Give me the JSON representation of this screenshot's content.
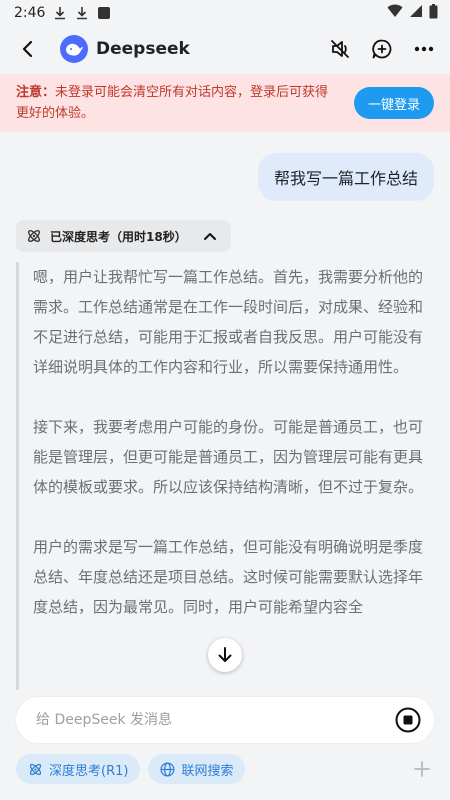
{
  "status_bar": {
    "time": "2:46",
    "icons": [
      "download-icon",
      "download-icon",
      "app-square-icon",
      "wifi-icon",
      "signal-icon",
      "battery-icon"
    ]
  },
  "header": {
    "title": "Deepseek",
    "icons": [
      "back-arrow-icon",
      "deepseek-whale-icon",
      "mute-icon",
      "new-chat-icon",
      "more-icon"
    ]
  },
  "notice": {
    "label": "注意：",
    "text": "未登录可能会清空所有对话内容，登录后可获得更好的体验。",
    "button": "一键登录"
  },
  "user_message": "帮我写一篇工作总结",
  "thinking": {
    "label": "已深度思考（用时18秒）",
    "paragraphs": [
      "嗯，用户让我帮忙写一篇工作总结。首先，我需要分析他的需求。工作总结通常是在工作一段时间后，对成果、经验和不足进行总结，可能用于汇报或者自我反思。用户可能没有详细说明具体的工作内容和行业，所以需要保持通用性。",
      "接下来，我要考虑用户可能的身份。可能是普通员工，也可能是管理层，但更可能是普通员工，因为管理层可能有更具体的模板或要求。所以应该保持结构清晰，但不过于复杂。",
      "用户的需求是写一篇工作总结，但可能没有明确说明是季度总结、年度总结还是项目总结。这时候可能需要默认选择年度总结，因为最常见。同时，用户可能希望内容全"
    ]
  },
  "input": {
    "placeholder": "给 DeepSeek 发消息",
    "value": ""
  },
  "chips": {
    "deep_think": "深度思考(R1)",
    "web_search": "联网搜索"
  },
  "colors": {
    "accent": "#4d6bfe",
    "notice_bg": "#fde3e4",
    "notice_text": "#c0392b",
    "login_button": "#1e9bf0",
    "chip_bg": "#dbeaf9",
    "chip_text": "#2d7fd3"
  }
}
